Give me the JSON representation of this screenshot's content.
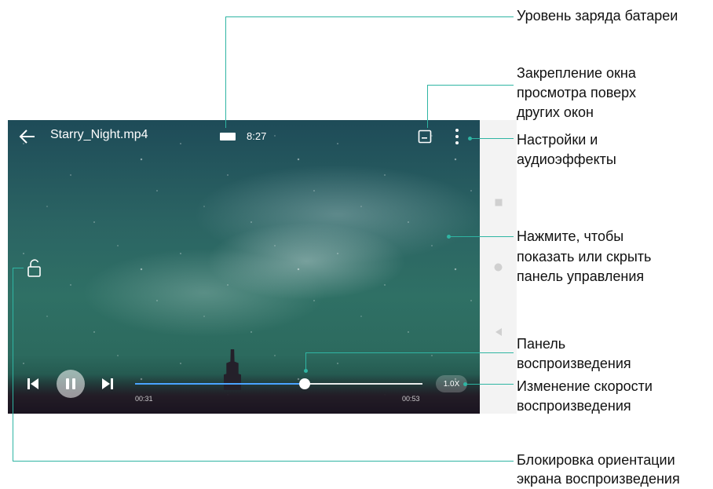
{
  "player": {
    "filename": "Starry_Night.mp4",
    "clock": "8:27",
    "current_time": "00:31",
    "total_time": "00:53",
    "speed": "1.0X",
    "progress": 0.59
  },
  "icons": {
    "back": "arrow-left-icon",
    "battery": "battery-icon",
    "float_window": "float-window-icon",
    "more": "more-vertical-icon",
    "lock": "unlock-icon",
    "previous": "skip-previous-icon",
    "pause": "pause-icon",
    "next": "skip-next-icon",
    "nav_square": "nav-recents-icon",
    "nav_circle": "nav-home-icon",
    "nav_triangle": "nav-back-icon"
  },
  "colors": {
    "callout": "#2fb5a3",
    "progress": "#4aa3ff"
  },
  "callouts": {
    "battery": "Уровень заряда батареи",
    "float_line1": "Закрепление окна",
    "float_line2": "просмотра поверх",
    "float_line3": "других окон",
    "settings_line1": "Настройки и",
    "settings_line2": "аудиоэффекты",
    "tap_line1": "Нажмите, чтобы",
    "tap_line2": "показать или скрыть",
    "tap_line3": "панель управления",
    "playbar_line1": "Панель",
    "playbar_line2": "воспроизведения",
    "speed_line1": "Изменение скорости",
    "speed_line2": "воспроизведения",
    "lock_line1": "Блокировка ориентации",
    "lock_line2": "экрана воспроизведения"
  }
}
